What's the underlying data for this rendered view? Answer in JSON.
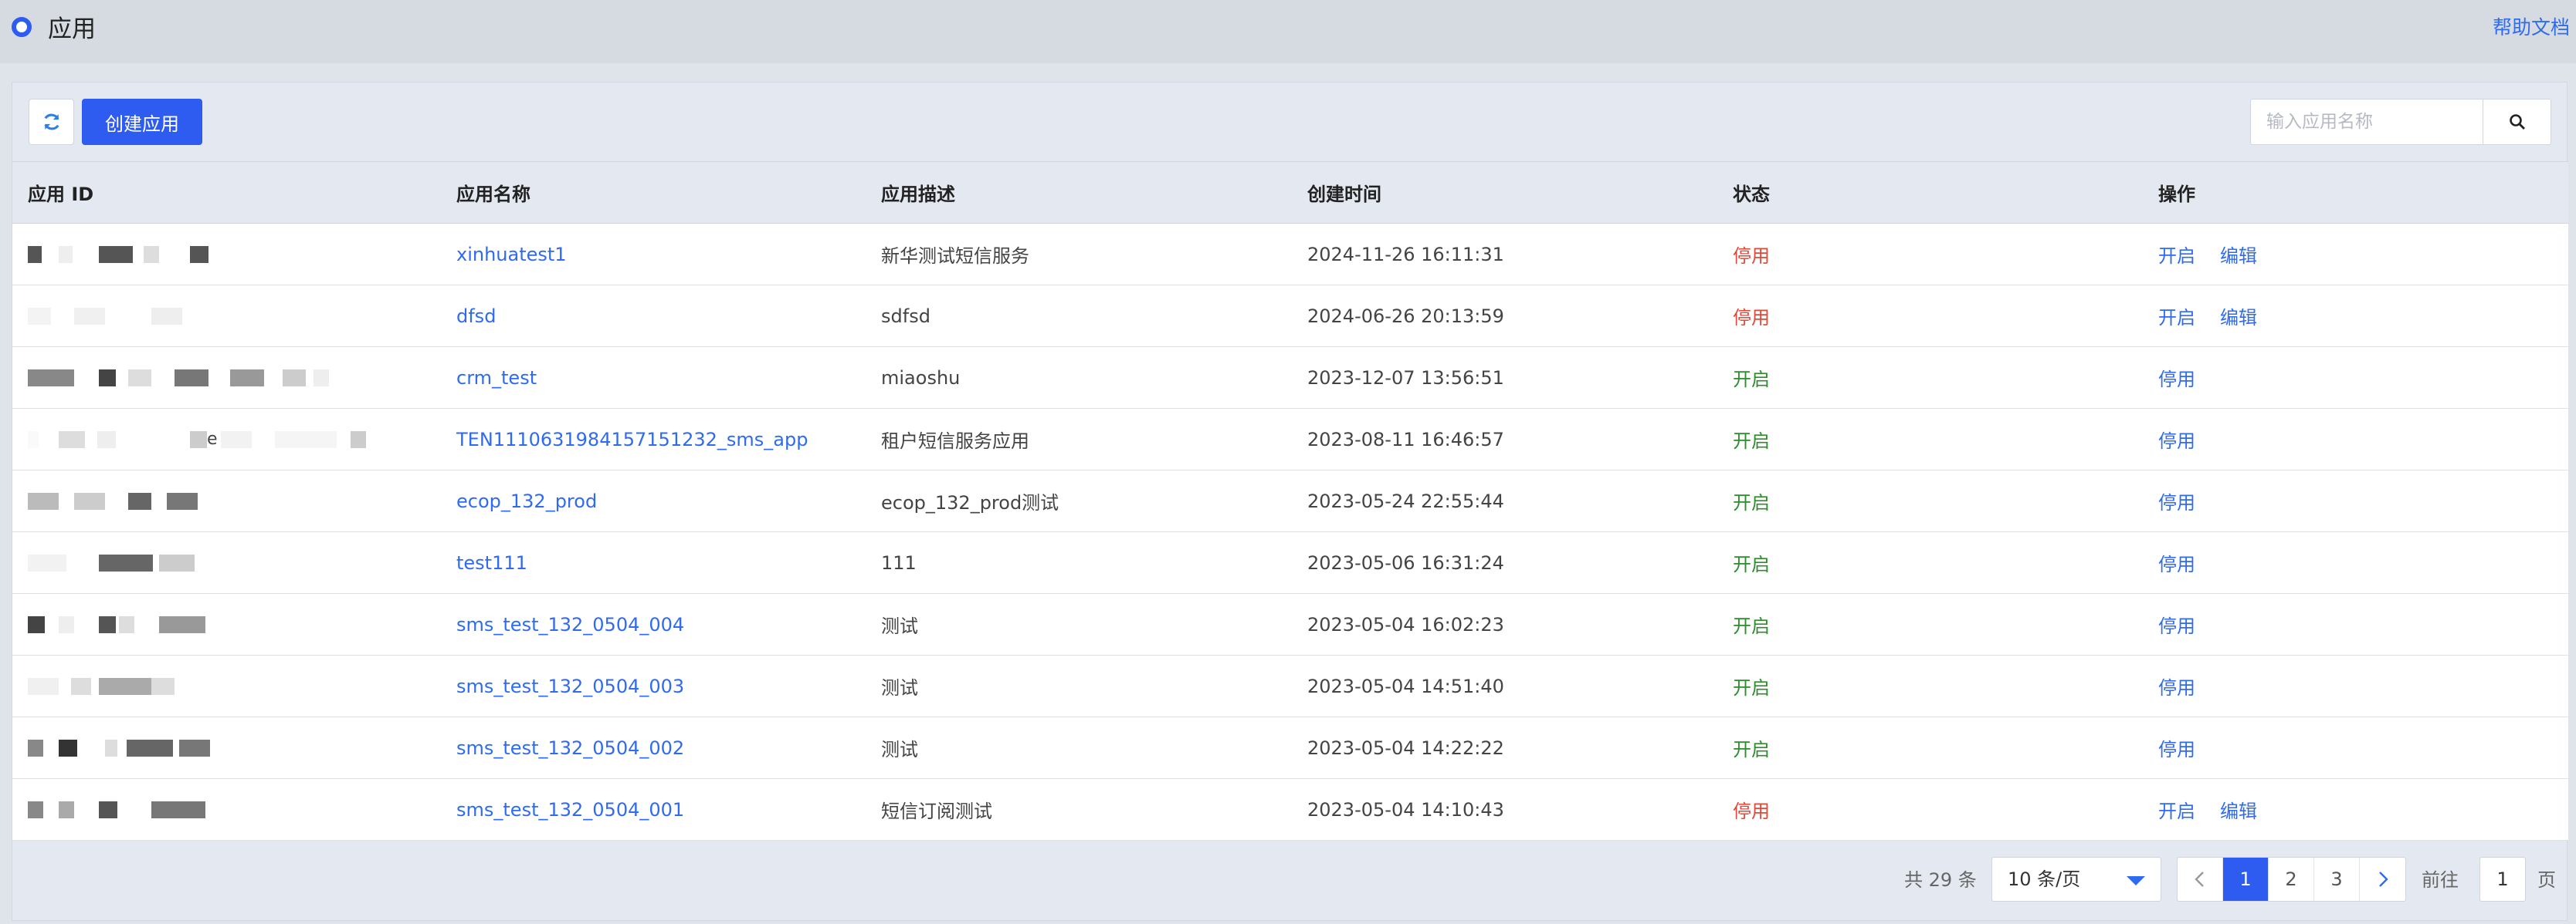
{
  "header": {
    "title": "应用",
    "help_link": "帮助文档"
  },
  "toolbar": {
    "create_button": "创建应用",
    "search_placeholder": "输入应用名称",
    "search_value": ""
  },
  "table": {
    "columns": [
      "应用 ID",
      "应用名称",
      "应用描述",
      "创建时间",
      "状态",
      "操作"
    ],
    "rows": [
      {
        "id_suffix": "",
        "name": "xinhuatest1",
        "description": "新华测试短信服务",
        "created": "2024-11-26 16:11:31",
        "status": "停用",
        "status_type": "stopped",
        "actions": [
          "开启",
          "编辑"
        ]
      },
      {
        "id_suffix": "",
        "name": "dfsd",
        "description": "sdfsd",
        "created": "2024-06-26 20:13:59",
        "status": "停用",
        "status_type": "stopped",
        "actions": [
          "开启",
          "编辑"
        ]
      },
      {
        "id_suffix": "",
        "name": "crm_test",
        "description": "miaoshu",
        "created": "2023-12-07 13:56:51",
        "status": "开启",
        "status_type": "active",
        "actions": [
          "停用"
        ]
      },
      {
        "id_suffix": "e",
        "name": "TEN111063198415715​1232_sms_app",
        "description": "租户短信服务应用",
        "created": "2023-08-11 16:46:57",
        "status": "开启",
        "status_type": "active",
        "actions": [
          "停用"
        ]
      },
      {
        "id_suffix": "",
        "name": "ecop_132_prod",
        "description": "ecop_132_prod测试",
        "created": "2023-05-24 22:55:44",
        "status": "开启",
        "status_type": "active",
        "actions": [
          "停用"
        ]
      },
      {
        "id_suffix": "",
        "name": "test111",
        "description": "111",
        "created": "2023-05-06 16:31:24",
        "status": "开启",
        "status_type": "active",
        "actions": [
          "停用"
        ]
      },
      {
        "id_suffix": "",
        "name": "sms_test_132_0504_004",
        "description": "测试",
        "created": "2023-05-04 16:02:23",
        "status": "开启",
        "status_type": "active",
        "actions": [
          "停用"
        ]
      },
      {
        "id_suffix": "",
        "name": "sms_test_132_0504_003",
        "description": "测试",
        "created": "2023-05-04 14:51:40",
        "status": "开启",
        "status_type": "active",
        "actions": [
          "停用"
        ]
      },
      {
        "id_suffix": "",
        "name": "sms_test_132_0504_002",
        "description": "测试",
        "created": "2023-05-04 14:22:22",
        "status": "开启",
        "status_type": "active",
        "actions": [
          "停用"
        ]
      },
      {
        "id_suffix": "",
        "name": "sms_test_132_0504_001",
        "description": "短信订阅测试",
        "created": "2023-05-04 14:10:43",
        "status": "停用",
        "status_type": "stopped",
        "actions": [
          "开启",
          "编辑"
        ]
      }
    ]
  },
  "pagination": {
    "total_text": "共 29 条",
    "page_size": "10 条/页",
    "pages": [
      "1",
      "2",
      "3"
    ],
    "current_page": "1",
    "goto_label": "前往",
    "goto_value": "1",
    "page_unit": "页"
  },
  "colors": {
    "accent": "#2f5cf0",
    "link": "#2f6bf0",
    "status_stopped": "#e04a3a",
    "status_active": "#2e8b2e"
  },
  "icons": {
    "refresh": "refresh-icon",
    "search": "search-icon",
    "prev": "chevron-left-icon",
    "next": "chevron-right-icon",
    "logo": "ring-logo-icon",
    "dropdown": "caret-down-icon"
  }
}
